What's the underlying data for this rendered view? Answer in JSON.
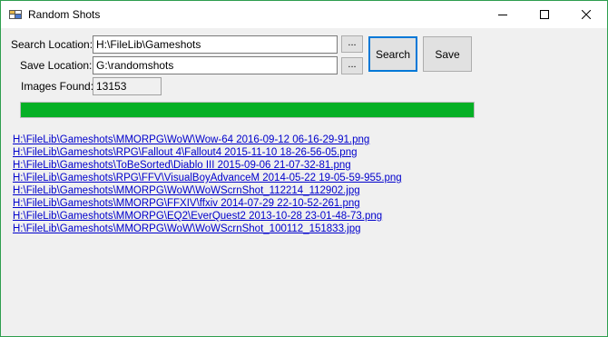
{
  "window": {
    "title": "Random Shots",
    "controls": {
      "minimize": "minimize",
      "maximize": "maximize",
      "close": "close"
    }
  },
  "form": {
    "search_location_label": "Search Location:",
    "search_location_value": "H:\\FileLib\\Gameshots",
    "save_location_label": "Save Location:",
    "save_location_value": "G:\\randomshots",
    "images_found_label": "Images Found:",
    "images_found_value": "13153",
    "browse_search_label": "...",
    "browse_save_label": "...",
    "search_button_label": "Search",
    "save_button_label": "Save"
  },
  "progress": {
    "value_percent": 100,
    "color": "#06b025"
  },
  "results": [
    "H:\\FileLib\\Gameshots\\MMORPG\\WoW\\Wow-64 2016-09-12 06-16-29-91.png",
    "H:\\FileLib\\Gameshots\\RPG\\Fallout 4\\Fallout4 2015-11-10 18-26-56-05.png",
    "H:\\FileLib\\Gameshots\\ToBeSorted\\Diablo III 2015-09-06 21-07-32-81.png",
    "H:\\FileLib\\Gameshots\\RPG\\FFV\\VisualBoyAdvanceM 2014-05-22 19-05-59-955.png",
    "H:\\FileLib\\Gameshots\\MMORPG\\WoW\\WoWScrnShot_112214_112902.jpg",
    "H:\\FileLib\\Gameshots\\MMORPG\\FFXIV\\ffxiv 2014-07-29 22-10-52-261.png",
    "H:\\FileLib\\Gameshots\\MMORPG\\EQ2\\EverQuest2 2013-10-28 23-01-48-73.png",
    "H:\\FileLib\\Gameshots\\MMORPG\\WoW\\WoWScrnShot_100112_151833.jpg"
  ]
}
